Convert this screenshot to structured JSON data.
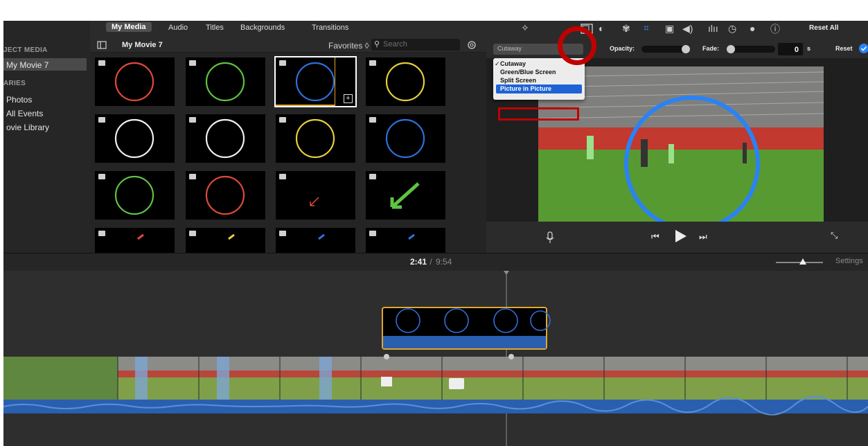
{
  "media_tabs": [
    "My Media",
    "Audio",
    "Titles",
    "Backgrounds",
    "Transitions"
  ],
  "browser": {
    "project_name": "My Movie 7",
    "favorites_label": "Favorites ◊",
    "search_placeholder": "Search"
  },
  "sidebar": {
    "project_section": "JECT MEDIA",
    "project_item": "My Movie 7",
    "libraries_section": "ARIES",
    "items": [
      "Photos",
      "All Events",
      "ovie Library"
    ]
  },
  "thumbnails": [
    {
      "kind": "circle",
      "color": "#e04a3c"
    },
    {
      "kind": "circle",
      "color": "#5ec442"
    },
    {
      "kind": "circle",
      "color": "#2f6fdb",
      "selected": true
    },
    {
      "kind": "circle",
      "color": "#e6cf3a"
    },
    {
      "kind": "circle",
      "color": "#f0f0f0"
    },
    {
      "kind": "circle",
      "color": "#f0f0f0"
    },
    {
      "kind": "circle",
      "color": "#e6cf3a"
    },
    {
      "kind": "circle",
      "color": "#2f6fdb"
    },
    {
      "kind": "circle",
      "color": "#5ec442"
    },
    {
      "kind": "circle",
      "color": "#e04a3c"
    },
    {
      "kind": "arrow-small",
      "color": "#e04a3c"
    },
    {
      "kind": "arrow-large",
      "color": "#5ec442"
    },
    {
      "kind": "arrow-partial",
      "color": "#e04a3c"
    },
    {
      "kind": "arrow-partial",
      "color": "#e6cf3a"
    },
    {
      "kind": "arrow-partial",
      "color": "#2f6fdb"
    },
    {
      "kind": "arrow-partial",
      "color": "#2f6fdb"
    }
  ],
  "toolbar": {
    "reset_all": "Reset All"
  },
  "overlay": {
    "mode_value": "Cutaway",
    "opacity_label": "Opacity:",
    "fade_label": "Fade:",
    "fade_value": "0",
    "fade_unit": "s",
    "reset_label": "Reset",
    "options": [
      "Cutaway",
      "Green/Blue Screen",
      "Split Screen",
      "Picture in Picture"
    ],
    "checked": "Cutaway",
    "highlighted": "Picture in Picture"
  },
  "timeline": {
    "current_time": "2:41",
    "separator": " / ",
    "total_time": "9:54",
    "settings_label": "Settings"
  },
  "colors": {
    "accent_blue": "#2a82f5",
    "overlay_clip_border": "#e0a82e",
    "audio_blue": "#2a5fb0",
    "annotation_red": "#c00000"
  }
}
